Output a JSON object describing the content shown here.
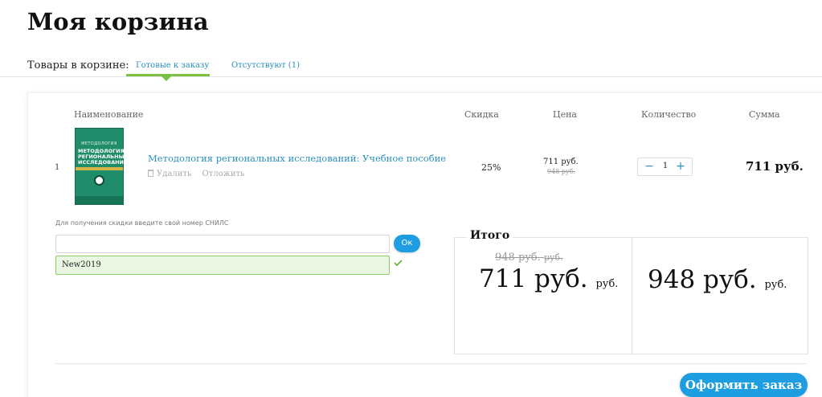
{
  "page": {
    "title": "Моя корзина"
  },
  "tabs": {
    "label": "Товары в корзине:",
    "ready": "Готовые к заказу",
    "missing": "Отсутствуют (1)"
  },
  "table": {
    "headers": {
      "name": "Наименование",
      "discount": "Скидка",
      "price": "Цена",
      "quantity": "Количество",
      "sum": "Сумма"
    },
    "row": {
      "index": "1",
      "book_cover": {
        "top_text": "МЕТОДОЛОГИЯ",
        "title": "МЕТОДОЛОГИЯ РЕГИОНАЛЬНЫХ ИССЛЕДОВАНИЙ"
      },
      "title": "Методология региональных исследований: Учебное пособие",
      "delete_label": "Удалить",
      "postpone_label": "Отложить",
      "discount": "25%",
      "price_new": "711 руб.",
      "price_old": "948 руб.",
      "quantity": "1",
      "sum": "711 руб."
    }
  },
  "snils": {
    "label": "Для получения скидки введите свой номер СНИЛС",
    "value": "",
    "ok_label": "Ок"
  },
  "promo": {
    "value": "New2019"
  },
  "totals": {
    "label": "Итого",
    "old_amount": "948 руб.",
    "old_unit": "руб.",
    "new_amount": "711 руб.",
    "new_unit": "руб.",
    "full_amount": "948 руб.",
    "full_unit": "руб."
  },
  "order_button": "Оформить заказ",
  "colors": {
    "accent": "#1e9ee0",
    "link": "#2a8fbd",
    "tab_underline": "#7ac143",
    "promo_bg": "#eaf6e2"
  }
}
